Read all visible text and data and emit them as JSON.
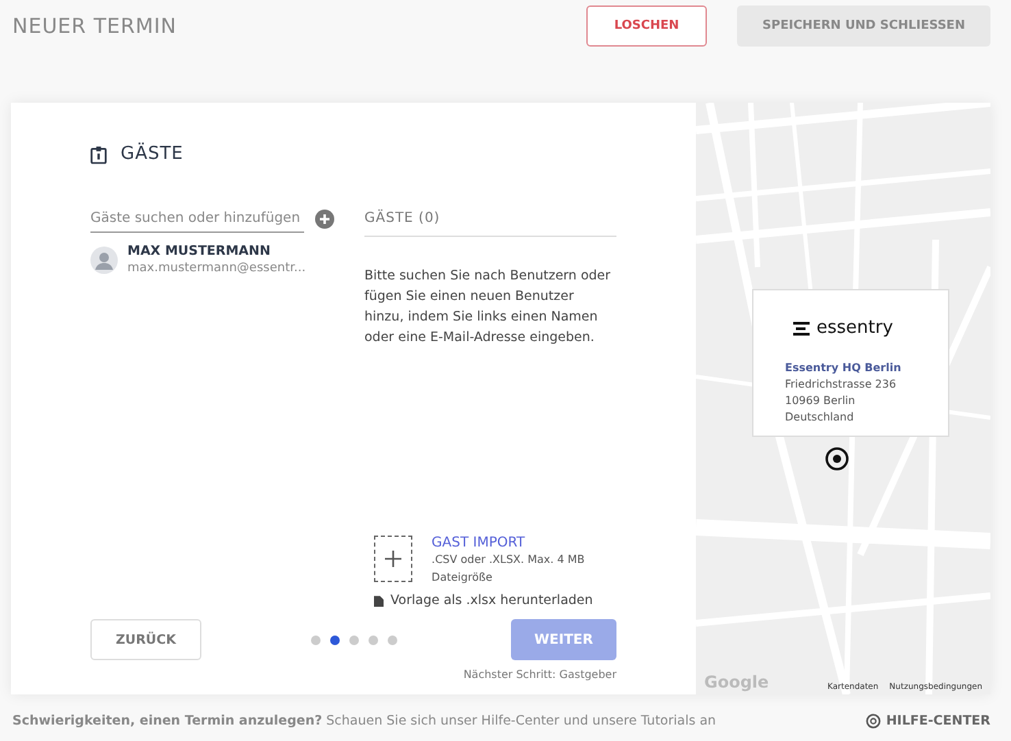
{
  "header": {
    "title": "NEUER TERMIN",
    "buttons": [
      {
        "kind": "danger",
        "label": "LOSCHEN"
      },
      {
        "kind": "neutral",
        "label": "SPEICHERN UND SCHLIESSEN"
      }
    ]
  },
  "section": {
    "title": "GÄSTE"
  },
  "search": {
    "placeholder": "Gäste suchen oder hinzufügen"
  },
  "results": [
    {
      "name": "MAX MUSTERMANN",
      "email": "max.mustermann@essentr..."
    }
  ],
  "guests": {
    "heading": "GÄSTE (0)",
    "hint": "Bitte suchen Sie nach Benutzern oder fügen Sie einen neuen Benutzer hinzu, indem Sie links einen Namen oder eine E-Mail-Adresse eingeben."
  },
  "import": {
    "title": "GAST IMPORT",
    "description": ".CSV oder .XLSX. Max. 4 MB Dateigröße",
    "template_link": "Vorlage als .xlsx herunterladen"
  },
  "back_button": "ZURÜCK",
  "steps": [
    {
      "selected": false
    },
    {
      "selected": true
    },
    {
      "selected": false
    },
    {
      "selected": false
    },
    {
      "selected": false
    }
  ],
  "next_button": {
    "label": "WEITER",
    "disabled": true
  },
  "next_step": "Nächster Schritt: Gastgeber",
  "map": {
    "logo": "essentry",
    "place": "Essentry HQ Berlin",
    "address": [
      "Friedrichstrasse 236",
      "10969 Berlin",
      "Deutschland"
    ],
    "provider": "Google",
    "links": [
      "Kartendaten",
      "Nutzungsbedingungen"
    ]
  },
  "footer": {
    "text": "**Schwierigkeiten, einen Termin anzulegen?** Schauen Sie sich unser Hilfe-Center und unsere Tutorials an",
    "help_link": "HILFE-CENTER"
  }
}
